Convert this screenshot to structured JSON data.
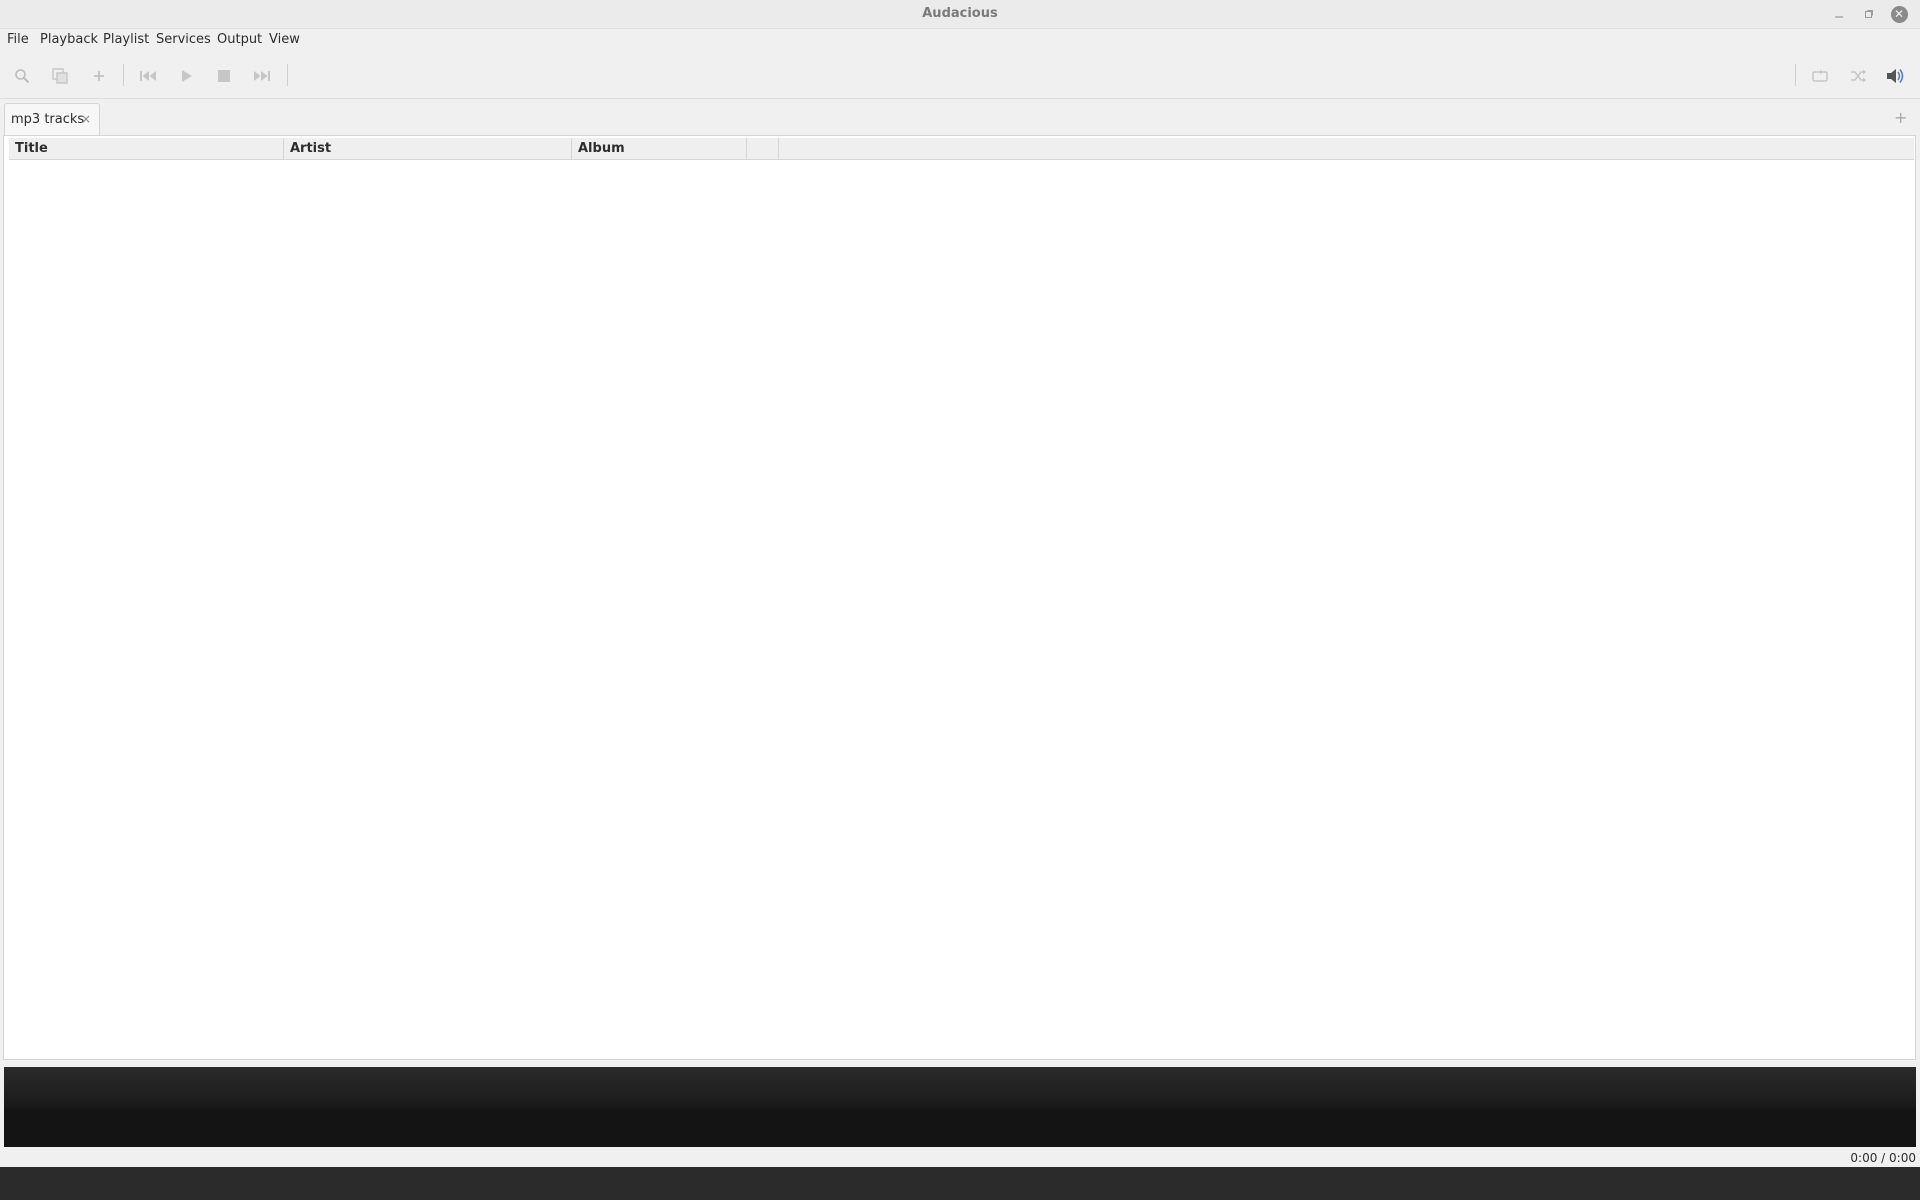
{
  "window": {
    "title": "Audacious"
  },
  "menubar": {
    "items": [
      {
        "label": "File"
      },
      {
        "label": "Playback"
      },
      {
        "label": "Playlist"
      },
      {
        "label": "Services"
      },
      {
        "label": "Output"
      },
      {
        "label": "View"
      }
    ]
  },
  "toolbar": {
    "buttons": [
      {
        "icon": "search-icon",
        "enabled": false
      },
      {
        "icon": "open-files-icon",
        "enabled": false
      },
      {
        "icon": "add-icon",
        "enabled": false
      },
      {
        "icon": "previous-track-icon",
        "enabled": false
      },
      {
        "icon": "play-icon",
        "enabled": false
      },
      {
        "icon": "stop-icon",
        "enabled": false
      },
      {
        "icon": "next-track-icon",
        "enabled": false
      },
      {
        "icon": "repeat-icon",
        "enabled": false
      },
      {
        "icon": "shuffle-icon",
        "enabled": false
      },
      {
        "icon": "volume-icon",
        "enabled": true
      }
    ]
  },
  "tabs": [
    {
      "label": "mp3 tracks",
      "close": "×"
    }
  ],
  "tab_add": "+",
  "playlist": {
    "columns": [
      {
        "label": "Title"
      },
      {
        "label": "Artist"
      },
      {
        "label": "Album"
      },
      {
        "label": ""
      }
    ],
    "rows": []
  },
  "status": {
    "time": "0:00 / 0:00"
  },
  "colors": {
    "background": "#f0f0f0",
    "info_area": "#1c1c1c",
    "disabled_icon": "#bdbdbd"
  }
}
